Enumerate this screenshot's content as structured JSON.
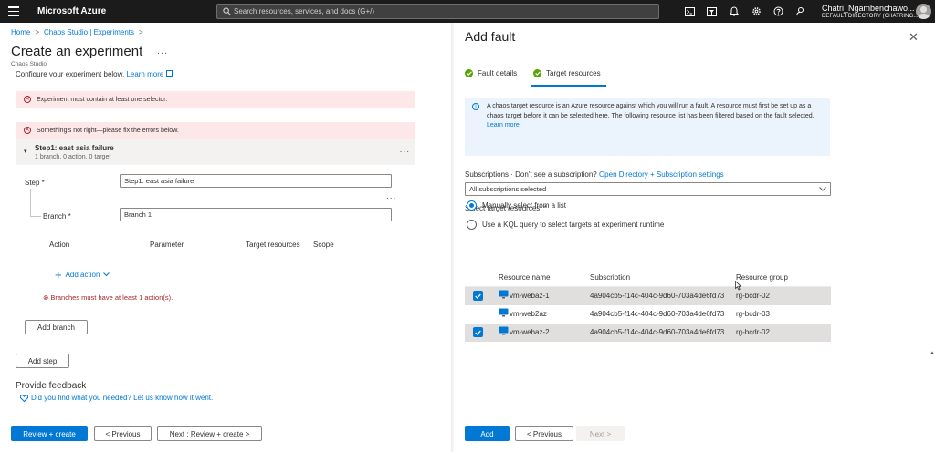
{
  "topbar": {
    "brand": "Microsoft Azure",
    "search_placeholder": "Search resources, services, and docs (G+/)",
    "icons": [
      "cloud-shell-icon",
      "portal-filter-icon",
      "bell-icon",
      "gear-icon",
      "help-icon",
      "feedback-icon"
    ],
    "account_name": "Chatri_Ngambenchawo...",
    "account_dir": "DEFAULT DIRECTORY (CHATRING..."
  },
  "breadcrumb": {
    "items": [
      "Home",
      "Chaos Studio | Experiments"
    ],
    "separator": ">"
  },
  "page": {
    "title": "Create an experiment",
    "more": "...",
    "subtitle": "Chaos Studio",
    "intro": "Configure your experiment below.",
    "intro_link": "Learn more"
  },
  "errors": {
    "selector": "Experiment must contain at least one selector.",
    "general": "Something's not right—please fix the errors below."
  },
  "step": {
    "title": "Step1: east asia failure",
    "summary": "1 branch, 0 action, 0 target",
    "more": "...",
    "step_label": "Step *",
    "step_value": "Step1: east asia failure",
    "branch_label": "Branch *",
    "branch_value": "Branch 1",
    "branch_more": "...",
    "columns": [
      "Action",
      "Parameter",
      "Target resources",
      "Scope"
    ],
    "add_action": "Add action",
    "branch_error": "Branches must have at least 1 action(s).",
    "add_branch": "Add branch"
  },
  "add_step": "Add step",
  "feedback": {
    "title": "Provide feedback",
    "link": "Did you find what you needed? Let us know how it went."
  },
  "footer": {
    "review_create": "Review + create",
    "previous": "< Previous",
    "next": "Next : Review + create >"
  },
  "panel": {
    "title": "Add fault",
    "close": "✕",
    "tabs": [
      "Fault details",
      "Target resources"
    ],
    "info_text": "A chaos target resource is an Azure resource against which you will run a fault. A resource must first be set up as a chaos target before it can be selected here. The following resource list has been filtered based on the fault selected.",
    "info_link": "Learn more",
    "subs_prefix": "Subscriptions · Don't see a subscription?",
    "subs_link": "Open Directory + Subscription settings",
    "subs_value": "All subscriptions selected",
    "select_label": "Select target resources: *",
    "radio_list": "Manually select from a list",
    "radio_kql": "Use a KQL query to select targets at experiment runtime",
    "columns": [
      "Resource name",
      "Subscription",
      "Resource group"
    ],
    "rows": [
      {
        "name": "vm-webaz-1",
        "subscription": "4a904cb5-f14c-404c-9d60-703a4de6fd73",
        "group": "rg-bcdr-02",
        "selected": true
      },
      {
        "name": "vm-web2az",
        "subscription": "4a904cb5-f14c-404c-9d60-703a4de6fd73",
        "group": "rg-bcdr-03",
        "selected": false
      },
      {
        "name": "vm-webaz-2",
        "subscription": "4a904cb5-f14c-404c-9d60-703a4de6fd73",
        "group": "rg-bcdr-02",
        "selected": true
      }
    ],
    "add": "Add",
    "previous": "< Previous",
    "next": "Next >"
  },
  "colors": {
    "accent": "#0078d4",
    "error": "#a4262c",
    "error_bg": "#fde7e9",
    "success": "#57a300",
    "topbar": "#1b1b1b"
  }
}
